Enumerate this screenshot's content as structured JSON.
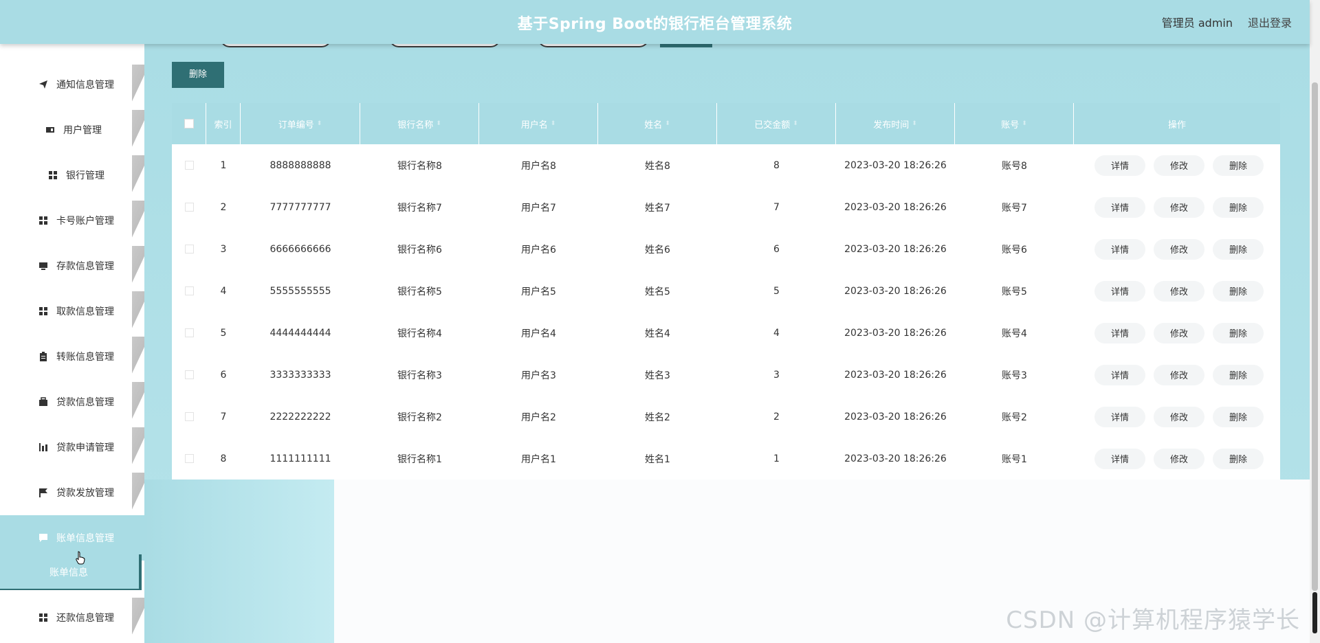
{
  "header": {
    "title": "基于Spring Boot的银行柜台管理系统",
    "user": "管理员 admin",
    "logout": "退出登录"
  },
  "sidebar": {
    "items": [
      {
        "label": "通知信息管理",
        "icon": "send-icon"
      },
      {
        "label": "用户管理",
        "icon": "id-card-icon"
      },
      {
        "label": "银行管理",
        "icon": "grid-icon"
      },
      {
        "label": "卡号账户管理",
        "icon": "grid-icon"
      },
      {
        "label": "存款信息管理",
        "icon": "monitor-icon"
      },
      {
        "label": "取款信息管理",
        "icon": "grid-icon"
      },
      {
        "label": "转账信息管理",
        "icon": "clipboard-icon"
      },
      {
        "label": "贷款信息管理",
        "icon": "briefcase-icon"
      },
      {
        "label": "贷款申请管理",
        "icon": "bar-chart-icon"
      },
      {
        "label": "贷款发放管理",
        "icon": "flag-icon"
      },
      {
        "label": "账单信息管理",
        "icon": "comment-icon"
      },
      {
        "label": "还款信息管理",
        "icon": "grid-icon"
      }
    ],
    "active_index": 10,
    "submenu_label": "账单信息"
  },
  "toolbar": {
    "delete_label": "删除"
  },
  "table": {
    "columns": [
      "索引",
      "订单编号",
      "银行名称",
      "用户名",
      "姓名",
      "已交金额",
      "发布时间",
      "账号",
      "操作"
    ],
    "rows": [
      {
        "index": "1",
        "order_no": "8888888888",
        "bank": "银行名称8",
        "username": "用户名8",
        "name": "姓名8",
        "paid": "8",
        "time": "2023-03-20 18:26:26",
        "account": "账号8"
      },
      {
        "index": "2",
        "order_no": "7777777777",
        "bank": "银行名称7",
        "username": "用户名7",
        "name": "姓名7",
        "paid": "7",
        "time": "2023-03-20 18:26:26",
        "account": "账号7"
      },
      {
        "index": "3",
        "order_no": "6666666666",
        "bank": "银行名称6",
        "username": "用户名6",
        "name": "姓名6",
        "paid": "6",
        "time": "2023-03-20 18:26:26",
        "account": "账号6"
      },
      {
        "index": "4",
        "order_no": "5555555555",
        "bank": "银行名称5",
        "username": "用户名5",
        "name": "姓名5",
        "paid": "5",
        "time": "2023-03-20 18:26:26",
        "account": "账号5"
      },
      {
        "index": "5",
        "order_no": "4444444444",
        "bank": "银行名称4",
        "username": "用户名4",
        "name": "姓名4",
        "paid": "4",
        "time": "2023-03-20 18:26:26",
        "account": "账号4"
      },
      {
        "index": "6",
        "order_no": "3333333333",
        "bank": "银行名称3",
        "username": "用户名3",
        "name": "姓名3",
        "paid": "3",
        "time": "2023-03-20 18:26:26",
        "account": "账号3"
      },
      {
        "index": "7",
        "order_no": "2222222222",
        "bank": "银行名称2",
        "username": "用户名2",
        "name": "姓名2",
        "paid": "2",
        "time": "2023-03-20 18:26:26",
        "account": "账号2"
      },
      {
        "index": "8",
        "order_no": "1111111111",
        "bank": "银行名称1",
        "username": "用户名1",
        "name": "姓名1",
        "paid": "1",
        "time": "2023-03-20 18:26:26",
        "account": "账号1"
      }
    ],
    "actions": {
      "detail": "详情",
      "edit": "修改",
      "delete": "删除"
    }
  },
  "watermark": "CSDN @计算机程序猿学长",
  "colors": {
    "theme": "#a9dce4",
    "accent_dark": "#2f6f74",
    "header_text": "#ffffff"
  }
}
